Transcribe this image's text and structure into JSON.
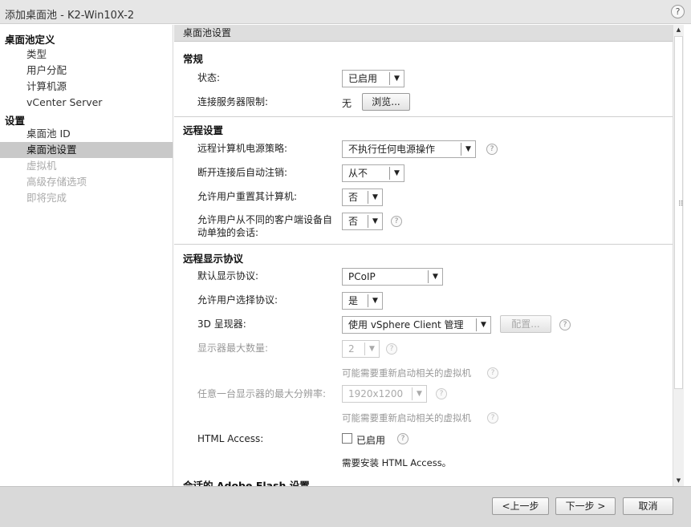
{
  "window": {
    "title": "添加桌面池 - K2-Win10X-2",
    "help": "?"
  },
  "sidebar": {
    "sections": [
      {
        "heading": "桌面池定义",
        "items": [
          {
            "label": "类型",
            "state": "normal"
          },
          {
            "label": "用户分配",
            "state": "normal"
          },
          {
            "label": "计算机源",
            "state": "normal"
          },
          {
            "label": "vCenter Server",
            "state": "normal"
          }
        ]
      },
      {
        "heading": "设置",
        "items": [
          {
            "label": "桌面池 ID",
            "state": "normal"
          },
          {
            "label": "桌面池设置",
            "state": "active"
          },
          {
            "label": "虚拟机",
            "state": "disabled"
          },
          {
            "label": "高级存储选项",
            "state": "disabled"
          },
          {
            "label": "即将完成",
            "state": "disabled"
          }
        ]
      }
    ]
  },
  "panel": {
    "header": "桌面池设置",
    "general": {
      "title": "常规",
      "status_label": "状态:",
      "status_value": "已启用",
      "conn_label": "连接服务器限制:",
      "conn_value": "无",
      "browse_button": "浏览..."
    },
    "remote": {
      "title": "远程设置",
      "power_label": "远程计算机电源策略:",
      "power_value": "不执行任何电源操作",
      "logoff_label": "断开连接后自动注销:",
      "logoff_value": "从不",
      "reset_label": "允许用户重置其计算机:",
      "reset_value": "否",
      "sessions_label_1": "允许用户从不同的客户端设备自",
      "sessions_label_2": "动单独的会话:",
      "sessions_value": "否"
    },
    "display": {
      "title": "远程显示协议",
      "protocol_label": "默认显示协议:",
      "protocol_value": "PCoIP",
      "choose_label": "允许用户选择协议:",
      "choose_value": "是",
      "renderer_label": "3D 呈现器:",
      "renderer_value": "使用 vSphere Client 管理",
      "config_button": "配置...",
      "monitors_label": "显示器最大数量:",
      "monitors_value": "2",
      "restart_note": "可能需要重新启动相关的虚拟机",
      "resolution_label": "任意一台显示器的最大分辨率:",
      "resolution_value": "1920x1200",
      "restart_note_2": "可能需要重新启动相关的虚拟机",
      "html_access_label": "HTML Access:",
      "html_access_checkbox": "已启用",
      "html_access_note": "需要安装 HTML Access。"
    },
    "flash": {
      "title": "会话的 Adobe Flash 设置"
    }
  },
  "footer": {
    "back_button": "<上一步",
    "next_button": "下一步 >",
    "cancel_button": "取消"
  }
}
